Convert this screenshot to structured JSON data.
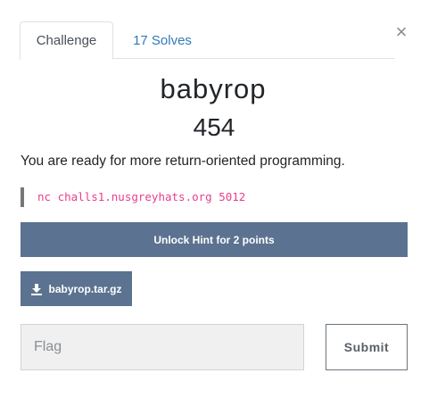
{
  "tabs": [
    {
      "label": "Challenge",
      "active": true
    },
    {
      "label": "17 Solves",
      "active": false
    }
  ],
  "close_icon": "×",
  "challenge": {
    "name": "babyrop",
    "points": "454",
    "description": "You are ready for more return-oriented programming.",
    "connection": "nc challs1.nusgreyhats.org 5012"
  },
  "hint_button": "Unlock Hint for 2 points",
  "file": {
    "name": "babyrop.tar.gz",
    "icon": "download-icon"
  },
  "flag_input": {
    "placeholder": "Flag",
    "value": ""
  },
  "submit_label": "Submit",
  "colors": {
    "button_bg": "#5b7290",
    "link": "#337ab7",
    "code": "#e83e8c"
  }
}
